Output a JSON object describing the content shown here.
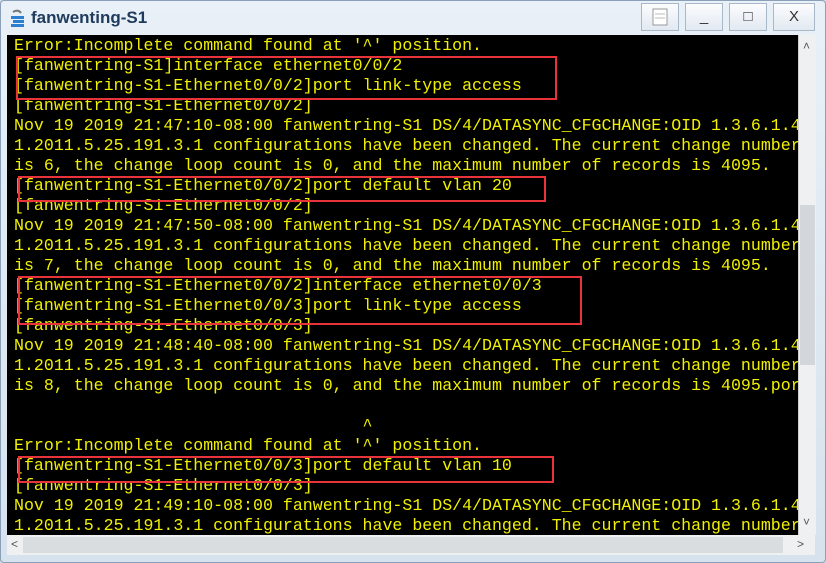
{
  "window": {
    "title": "fanwenting-S1",
    "controls": {
      "minimize": "_",
      "maximize": "□",
      "close": "X"
    }
  },
  "terminal": {
    "lines": [
      "Error:Incomplete command found at '^' position.",
      "[fanwentring-S1]interface ethernet0/0/2",
      "[fanwentring-S1-Ethernet0/0/2]port link-type access",
      "[fanwentring-S1-Ethernet0/0/2]",
      "Nov 19 2019 21:47:10-08:00 fanwentring-S1 DS/4/DATASYNC_CFGCHANGE:OID 1.3.6.1.4",
      "1.2011.5.25.191.3.1 configurations have been changed. The current change number",
      "is 6, the change loop count is 0, and the maximum number of records is 4095.",
      "[fanwentring-S1-Ethernet0/0/2]port default vlan 20",
      "[fanwentring-S1-Ethernet0/0/2]",
      "Nov 19 2019 21:47:50-08:00 fanwentring-S1 DS/4/DATASYNC_CFGCHANGE:OID 1.3.6.1.4",
      "1.2011.5.25.191.3.1 configurations have been changed. The current change number",
      "is 7, the change loop count is 0, and the maximum number of records is 4095.",
      "[fanwentring-S1-Ethernet0/0/2]interface ethernet0/0/3",
      "[fanwentring-S1-Ethernet0/0/3]port link-type access",
      "[fanwentring-S1-Ethernet0/0/3]",
      "Nov 19 2019 21:48:40-08:00 fanwentring-S1 DS/4/DATASYNC_CFGCHANGE:OID 1.3.6.1.4",
      "1.2011.5.25.191.3.1 configurations have been changed. The current change number",
      "is 8, the change loop count is 0, and the maximum number of records is 4095.por",
      "",
      "                                   ^",
      "Error:Incomplete command found at '^' position.",
      "[fanwentring-S1-Ethernet0/0/3]port default vlan 10",
      "[fanwentring-S1-Ethernet0/0/3]",
      "Nov 19 2019 21:49:10-08:00 fanwentring-S1 DS/4/DATASYNC_CFGCHANGE:OID 1.3.6.1.4",
      "1.2011.5.25.191.3.1 configurations have been changed. The current change number"
    ]
  },
  "colors": {
    "terminal_bg": "#000000",
    "terminal_text": "#f0f000",
    "highlight": "#e8333a"
  }
}
